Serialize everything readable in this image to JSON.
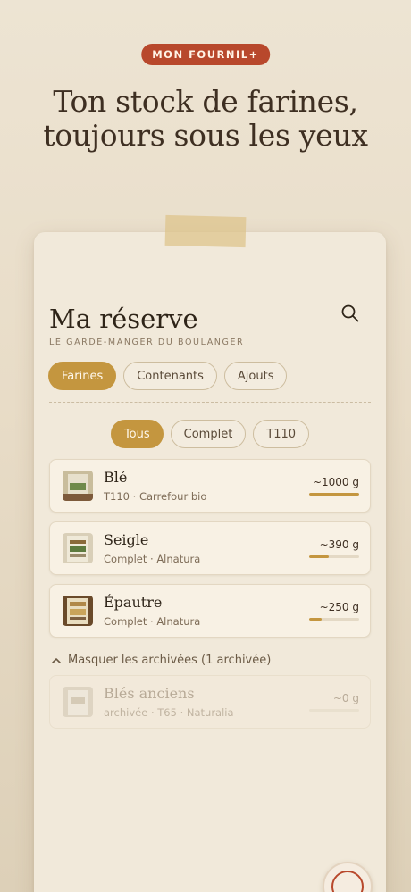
{
  "badge": "MON FOURNIL+",
  "headline": {
    "line1": "Ton stock de farines,",
    "line2": "toujours sous les yeux"
  },
  "screen": {
    "title": "Ma réserve",
    "subtitle": "LE GARDE-MANGER DU BOULANGER",
    "tabs": [
      {
        "label": "Farines",
        "active": true
      },
      {
        "label": "Contenants",
        "active": false
      },
      {
        "label": "Ajouts",
        "active": false
      }
    ],
    "filters": [
      {
        "label": "Tous",
        "active": true
      },
      {
        "label": "Complet",
        "active": false
      },
      {
        "label": "T110",
        "active": false
      }
    ],
    "items": [
      {
        "name": "Blé",
        "meta": "T110 · Carrefour bio",
        "qty": "~1000 g",
        "level": 1.0
      },
      {
        "name": "Seigle",
        "meta": "Complet · Alnatura",
        "qty": "~390 g",
        "level": 0.39
      },
      {
        "name": "Épautre",
        "meta": "Complet · Alnatura",
        "qty": "~250 g",
        "level": 0.25
      }
    ],
    "archive_toggle": "Masquer les archivées (1 archivée)",
    "archived_items": [
      {
        "name": "Blés anciens",
        "meta": "archivée · T65 · Naturalia",
        "qty": "~0 g",
        "level": 0.0
      }
    ]
  },
  "colors": {
    "accent": "#c4963f",
    "brand": "#b8482c",
    "background": "#ede4d3",
    "card": "#f1e9da"
  }
}
